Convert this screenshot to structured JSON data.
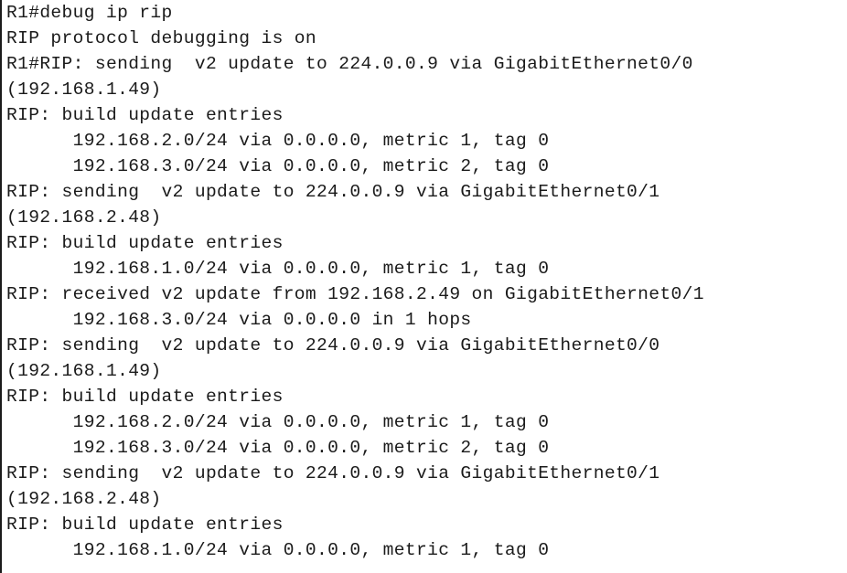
{
  "terminal": {
    "device_prompt": "R1#",
    "command": "debug ip rip",
    "status_message": "RIP protocol debugging is on",
    "text_color": "#1a1a1a",
    "background_color": "#ffffff",
    "border_color": "#1b1b1b",
    "lines": [
      {
        "id": "line-01",
        "text": "R1#debug ip rip"
      },
      {
        "id": "line-02",
        "text": "RIP protocol debugging is on"
      },
      {
        "id": "line-03",
        "text": "R1#RIP: sending  v2 update to 224.0.0.9 via GigabitEthernet0/0"
      },
      {
        "id": "line-04",
        "text": "(192.168.1.49)"
      },
      {
        "id": "line-05",
        "text": "RIP: build update entries"
      },
      {
        "id": "line-06",
        "text": "      192.168.2.0/24 via 0.0.0.0, metric 1, tag 0"
      },
      {
        "id": "line-07",
        "text": "      192.168.3.0/24 via 0.0.0.0, metric 2, tag 0"
      },
      {
        "id": "line-08",
        "text": "RIP: sending  v2 update to 224.0.0.9 via GigabitEthernet0/1"
      },
      {
        "id": "line-09",
        "text": "(192.168.2.48)"
      },
      {
        "id": "line-10",
        "text": "RIP: build update entries"
      },
      {
        "id": "line-11",
        "text": "      192.168.1.0/24 via 0.0.0.0, metric 1, tag 0"
      },
      {
        "id": "line-12",
        "text": "RIP: received v2 update from 192.168.2.49 on GigabitEthernet0/1"
      },
      {
        "id": "line-13",
        "text": "      192.168.3.0/24 via 0.0.0.0 in 1 hops"
      },
      {
        "id": "line-14",
        "text": "RIP: sending  v2 update to 224.0.0.9 via GigabitEthernet0/0"
      },
      {
        "id": "line-15",
        "text": "(192.168.1.49)"
      },
      {
        "id": "line-16",
        "text": "RIP: build update entries"
      },
      {
        "id": "line-17",
        "text": "      192.168.2.0/24 via 0.0.0.0, metric 1, tag 0"
      },
      {
        "id": "line-18",
        "text": "      192.168.3.0/24 via 0.0.0.0, metric 2, tag 0"
      },
      {
        "id": "line-19",
        "text": "RIP: sending  v2 update to 224.0.0.9 via GigabitEthernet0/1"
      },
      {
        "id": "line-20",
        "text": "(192.168.2.48)"
      },
      {
        "id": "line-21",
        "text": "RIP: build update entries"
      },
      {
        "id": "line-22",
        "text": "      192.168.1.0/24 via 0.0.0.0, metric 1, tag 0"
      }
    ]
  }
}
